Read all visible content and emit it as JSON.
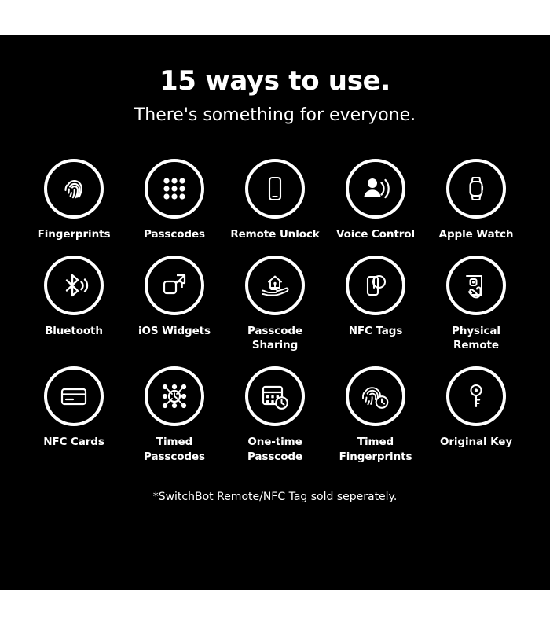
{
  "header": {
    "title": "15 ways to use.",
    "subtitle": "There's something for everyone."
  },
  "colors": {
    "background": "#000000",
    "page": "#ffffff",
    "foreground": "#ffffff"
  },
  "features": [
    {
      "icon": "fingerprint-icon",
      "label": "Fingerprints"
    },
    {
      "icon": "keypad-dots-icon",
      "label": "Passcodes"
    },
    {
      "icon": "smartphone-icon",
      "label": "Remote Unlock"
    },
    {
      "icon": "voice-person-icon",
      "label": "Voice Control"
    },
    {
      "icon": "apple-watch-icon",
      "label": "Apple Watch"
    },
    {
      "icon": "bluetooth-icon",
      "label": "Bluetooth"
    },
    {
      "icon": "widgets-squares-icon",
      "label": "iOS Widgets"
    },
    {
      "icon": "house-on-hand-icon",
      "label": "Passcode\nSharing"
    },
    {
      "icon": "nfc-phone-tag-icon",
      "label": "NFC Tags"
    },
    {
      "icon": "hand-remote-icon",
      "label": "Physical\nRemote"
    },
    {
      "icon": "card-icon",
      "label": "NFC Cards"
    },
    {
      "icon": "timed-passcode-icon",
      "label": "Timed\nPasscodes"
    },
    {
      "icon": "calendar-clock-icon",
      "label": "One-time\nPasscode"
    },
    {
      "icon": "fingerprint-clock-icon",
      "label": "Timed\nFingerprints"
    },
    {
      "icon": "key-icon",
      "label": "Original Key"
    }
  ],
  "footnote": "*SwitchBot Remote/NFC Tag sold seperately."
}
